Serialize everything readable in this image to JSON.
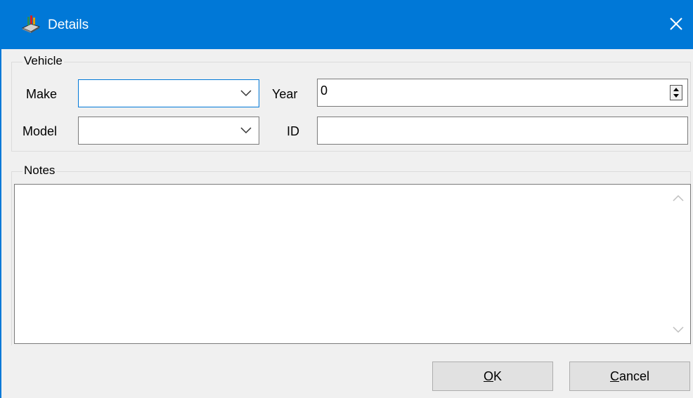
{
  "window": {
    "title": "Details",
    "accent_color": "#0078d7",
    "icons": {
      "app": "vehicle-app-icon",
      "close": "close-icon"
    }
  },
  "vehicle_group": {
    "legend": "Vehicle",
    "make_label": "Make",
    "make_value": "",
    "model_label": "Model",
    "model_value": "",
    "year_label": "Year",
    "year_value": "0",
    "id_label": "ID",
    "id_value": ""
  },
  "notes_group": {
    "legend": "Notes",
    "notes_value": ""
  },
  "buttons": {
    "ok_mnemonic": "O",
    "ok_rest": "K",
    "cancel_mnemonic": "C",
    "cancel_rest": "ancel"
  }
}
